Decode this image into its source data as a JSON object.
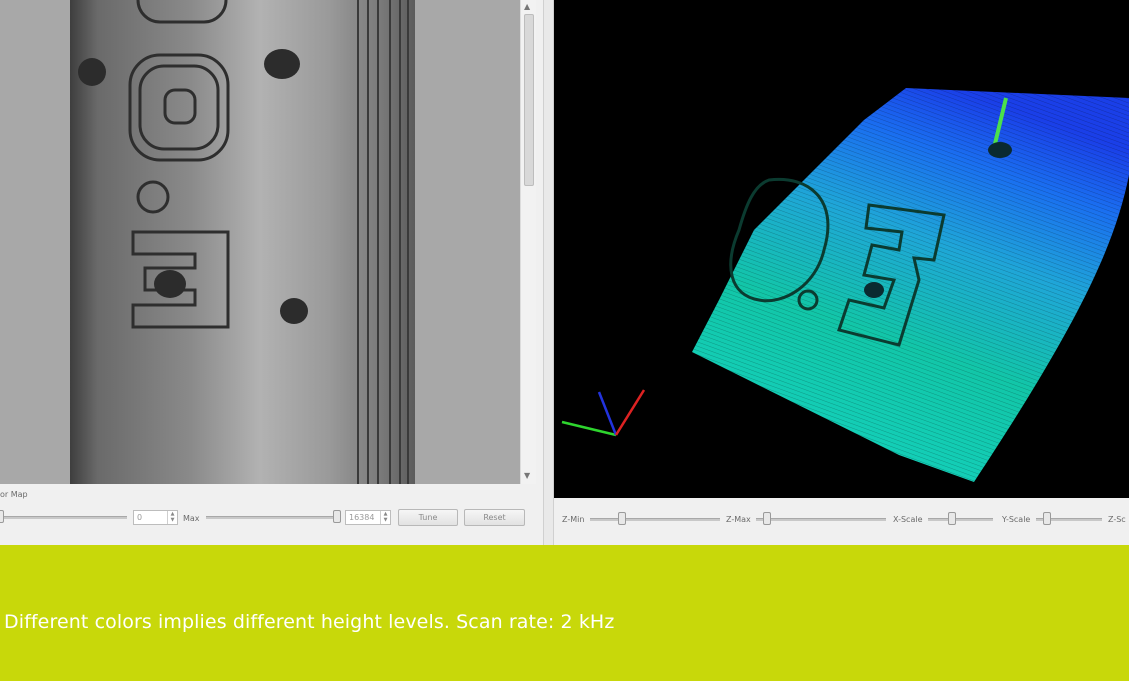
{
  "left_panel": {
    "group_label": "or Map",
    "min_value": "0",
    "max_label": "Max",
    "max_value": "16384",
    "tune_button": "Tune",
    "reset_button": "Reset",
    "image_icon": "grayscale-intensity-image"
  },
  "right_panel": {
    "view_icon": "3d-point-cloud-view",
    "axes_icon": "xyz-axes-gizmo",
    "sliders": [
      {
        "label": "Z-Min"
      },
      {
        "label": "Z-Max"
      },
      {
        "label": "X-Scale"
      },
      {
        "label": "Y-Scale"
      },
      {
        "label": "Z-Sc"
      }
    ]
  },
  "caption": {
    "text": "Different colors implies different height levels. Scan rate: 2 kHz",
    "band_color": "#c8d80a"
  }
}
